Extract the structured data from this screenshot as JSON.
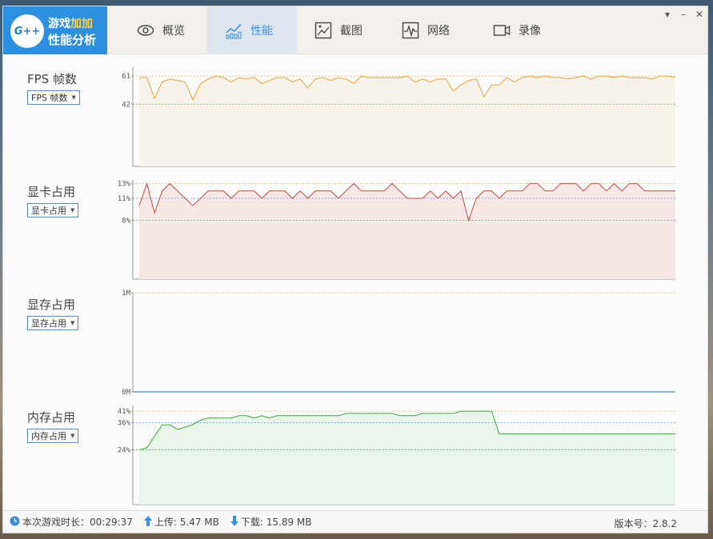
{
  "app": {
    "logo_badge": "G++",
    "logo_line1a": "游戏",
    "logo_line1b": "加加",
    "logo_line2": "性能分析"
  },
  "tabs": [
    {
      "label": "概览",
      "icon": "eye-icon"
    },
    {
      "label": "性能",
      "icon": "performance-chart-icon",
      "active": true
    },
    {
      "label": "截图",
      "icon": "image-icon"
    },
    {
      "label": "网络",
      "icon": "pulse-icon"
    },
    {
      "label": "录像",
      "icon": "video-camera-icon"
    }
  ],
  "window_controls": {
    "menu": "▾",
    "minimize": "–",
    "close": "✕"
  },
  "panels": {
    "fps": {
      "title": "FPS 帧数",
      "dropdown": "FPS 帧数"
    },
    "gpu": {
      "title": "显卡占用",
      "dropdown": "显卡占用"
    },
    "vram": {
      "title": "显存占用",
      "dropdown": "显存占用"
    },
    "mem": {
      "title": "内存占用",
      "dropdown": "内存占用"
    }
  },
  "status": {
    "session_time": "本次游戏时长：00:29:37",
    "upload": "上传: 5.47 MB",
    "download": "下载: 15.89 MB",
    "version": "版本号：2.8.2"
  },
  "colors": {
    "accent": "#3a8fdd",
    "fps_line": "#e8a23a",
    "fps_fill": "#f8f3ea",
    "gpu_line": "#c0493d",
    "gpu_fill": "#f7e8e6",
    "vram_line": "#4f8fb8",
    "mem_line": "#3aa83a",
    "mem_fill": "#e9f4ea",
    "ref_max": "#e7b567",
    "ref_min": "#5aa55a",
    "ref_avg": "#5b8fdf"
  },
  "chart_data": [
    {
      "type": "line",
      "title": "FPS 帧数",
      "ylim": [
        0,
        67
      ],
      "ref_lines": {
        "max": 61,
        "min": 42
      },
      "tick_labels": [
        "61",
        "42"
      ],
      "values": [
        60,
        60,
        46,
        57,
        59,
        58,
        57,
        45,
        56,
        59,
        61,
        60,
        57,
        60,
        59,
        60,
        56,
        58,
        60,
        60,
        57,
        59,
        53,
        59,
        60,
        58,
        60,
        59,
        56,
        61,
        60,
        60,
        60,
        60,
        60,
        61,
        57,
        59,
        57,
        59,
        59,
        51,
        55,
        58,
        59,
        47,
        55,
        55,
        60,
        57,
        60,
        61,
        60,
        61,
        60,
        60,
        59,
        60,
        61,
        59,
        61,
        61,
        60,
        61,
        60,
        60,
        60,
        59,
        61,
        61,
        60
      ]
    },
    {
      "type": "line",
      "title": "显卡占用",
      "ylim": [
        0,
        13.5
      ],
      "ref_lines": {
        "max": 13,
        "avg": 11,
        "min": 8
      },
      "tick_labels": [
        "13%",
        "11%",
        "8%"
      ],
      "values": [
        10,
        13,
        9,
        12,
        13,
        12,
        11,
        10,
        11,
        12,
        12,
        12,
        11,
        12,
        12,
        12,
        11,
        12,
        12,
        12,
        11,
        12,
        11,
        12,
        12,
        12,
        11,
        12,
        13,
        12,
        12,
        12,
        12,
        13,
        12,
        11,
        11,
        11,
        12,
        11,
        12,
        11,
        12,
        8,
        11,
        12,
        12,
        11,
        12,
        12,
        12,
        13,
        13,
        12,
        12,
        13,
        13,
        13,
        12,
        13,
        13,
        12,
        13,
        12,
        13,
        13,
        12,
        12,
        12,
        12,
        12
      ]
    },
    {
      "type": "line",
      "title": "显存占用",
      "ylim": [
        0,
        1
      ],
      "tick_labels": [
        "1M",
        "0M"
      ],
      "values": [
        0,
        0
      ]
    },
    {
      "type": "line",
      "title": "内存占用",
      "ylim": [
        0,
        43.5
      ],
      "ref_lines": {
        "max": 41,
        "avg": 36,
        "min": 24
      },
      "tick_labels": [
        "41%",
        "36%",
        "24%"
      ],
      "values": [
        24,
        25,
        30,
        35,
        35,
        33,
        34,
        35,
        37,
        38,
        38,
        38,
        38,
        39,
        39,
        38,
        39,
        38,
        39,
        39,
        39,
        39,
        39,
        39,
        39,
        39,
        39,
        40,
        40,
        40,
        40,
        40,
        40,
        40,
        39,
        39,
        39,
        40,
        40,
        40,
        40,
        40,
        41,
        41,
        41,
        41,
        41,
        31,
        31,
        31,
        31,
        31,
        31,
        31,
        31,
        31,
        31,
        31,
        31,
        31,
        31,
        31,
        31,
        31,
        31,
        31,
        31,
        31,
        31,
        31,
        31
      ]
    }
  ]
}
